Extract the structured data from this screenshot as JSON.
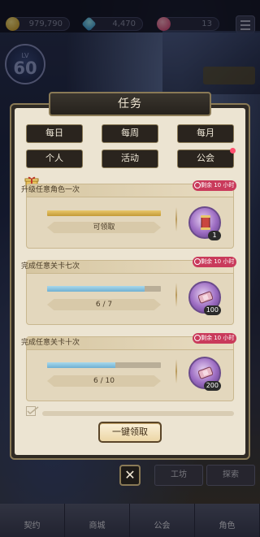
{
  "currency": {
    "gold": "979,790",
    "gems": "4,470",
    "hearts": "13"
  },
  "player": {
    "level_label": "LV",
    "level": "60"
  },
  "dialog": {
    "title": "任务",
    "tabs": [
      {
        "label": "每日",
        "active": true,
        "dot": false
      },
      {
        "label": "每周",
        "active": false,
        "dot": false
      },
      {
        "label": "每月",
        "active": false,
        "dot": false
      },
      {
        "label": "个人",
        "active": false,
        "dot": false
      },
      {
        "label": "活动",
        "active": false,
        "dot": false
      },
      {
        "label": "公会",
        "active": false,
        "dot": true
      }
    ],
    "tasks": [
      {
        "title": "升级任意角色一次",
        "badge": "剩余 10 小时",
        "progress_text": "可领取",
        "progress": 1.0,
        "bar_color": "#c39a36",
        "reward_icon": "scroll-icon",
        "reward_qty": "1"
      },
      {
        "title": "完成任意关卡七次",
        "badge": "剩余 10 小时",
        "progress_text": "6 / 7",
        "progress": 0.857,
        "bar_color": "#6fb0d2",
        "reward_icon": "ticket-icon",
        "reward_qty": "100"
      },
      {
        "title": "完成任意关卡十次",
        "badge": "剩余 10 小时",
        "progress_text": "6 / 10",
        "progress": 0.6,
        "bar_color": "#6fb0d2",
        "reward_icon": "ticket-icon",
        "reward_qty": "200"
      }
    ],
    "claim_all_label": "一键领取",
    "close_label": "✕"
  },
  "side_nav": {
    "workshop": "工坊",
    "explore": "探索"
  },
  "bottom_nav": [
    "契约",
    "商城",
    "公会",
    "角色"
  ]
}
